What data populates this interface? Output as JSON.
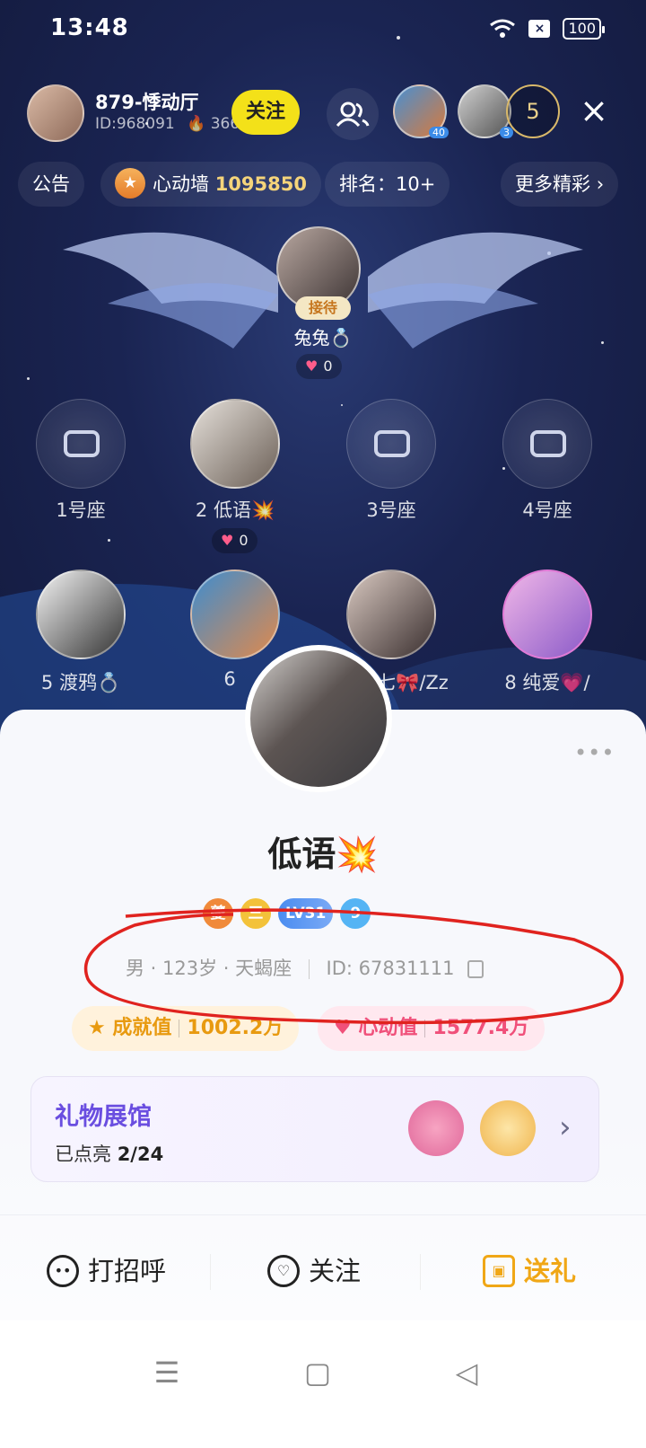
{
  "status_bar": {
    "time": "13:48",
    "battery": "100"
  },
  "room": {
    "title": "879-悸动厅",
    "id_label": "ID:968091",
    "heat": "366",
    "follow_label": "关注",
    "online_count": "5",
    "top_users": [
      {
        "badge": "40"
      },
      {
        "badge": "3"
      }
    ],
    "announcement_label": "公告",
    "heartwall_label": "心动墙",
    "heartwall_value": "1095850",
    "rank_label": "排名：10+",
    "more_label": "更多精彩"
  },
  "host": {
    "tag": "接待",
    "name": "兔兔💍",
    "hearts": "0"
  },
  "seats": [
    {
      "label": "1号座",
      "empty": true
    },
    {
      "label": "2  低语💥",
      "empty": false,
      "hearts": "0"
    },
    {
      "label": "3号座",
      "empty": true
    },
    {
      "label": "4号座",
      "empty": true
    },
    {
      "label": "5  渡鸦💍",
      "empty": false
    },
    {
      "label": "6",
      "empty": false
    },
    {
      "label": "七🎀/Zz",
      "empty": false
    },
    {
      "label": "8  纯爱💗/",
      "empty": false
    }
  ],
  "profile": {
    "name": "低语💥",
    "badges": [
      "夔",
      "三",
      "LV31",
      "9"
    ],
    "meta": "男 · 123岁 · 天蝎座",
    "id_text": "ID:  67831111",
    "achievement_label": "成就值",
    "achievement_value": "1002.2万",
    "heart_label": "心动值",
    "heart_value": "1577.4万",
    "more_icon": "•••"
  },
  "gift_hall": {
    "title": "礼物展馆",
    "lit_label": "已点亮",
    "lit_value": "2/24"
  },
  "actions": {
    "greet": "打招呼",
    "follow": "关注",
    "gift": "送礼"
  },
  "colors": {
    "room_bg": "#1a2452",
    "follow_yellow": "#f3e119",
    "gift_orange": "#f0a716",
    "gift_hall_title": "#6a4ee0",
    "annotation_red": "#e0231f"
  },
  "icons": [
    "wifi-icon",
    "close-icon",
    "members-icon",
    "star-icon",
    "chevron-right-icon",
    "sofa-icon",
    "heart-icon",
    "copy-icon",
    "chat-icon",
    "heart-plus-icon",
    "gift-icon",
    "menu-nav-icon",
    "home-nav-icon",
    "back-nav-icon"
  ]
}
